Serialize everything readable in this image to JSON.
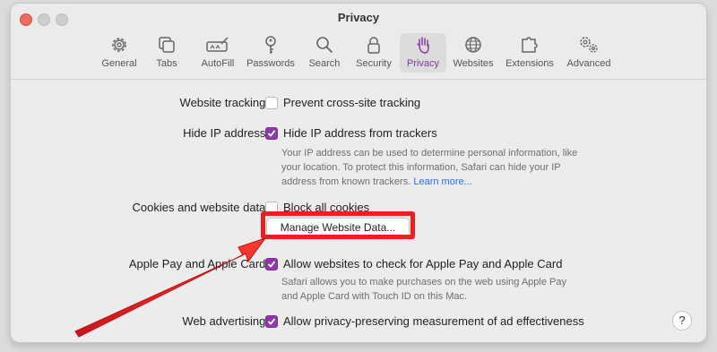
{
  "window": {
    "title": "Privacy"
  },
  "toolbar": {
    "tabs": [
      {
        "label": "General",
        "icon": "gear-icon"
      },
      {
        "label": "Tabs",
        "icon": "tabs-icon"
      },
      {
        "label": "AutoFill",
        "icon": "autofill-icon"
      },
      {
        "label": "Passwords",
        "icon": "key-icon"
      },
      {
        "label": "Search",
        "icon": "search-icon"
      },
      {
        "label": "Security",
        "icon": "lock-icon"
      },
      {
        "label": "Privacy",
        "icon": "hand-icon",
        "active": true
      },
      {
        "label": "Websites",
        "icon": "globe-icon"
      },
      {
        "label": "Extensions",
        "icon": "puzzle-icon"
      },
      {
        "label": "Advanced",
        "icon": "gears-icon"
      }
    ]
  },
  "settings": {
    "website_tracking": {
      "label": "Website tracking:",
      "option": "Prevent cross-site tracking",
      "checked": false
    },
    "hide_ip": {
      "label": "Hide IP address:",
      "option": "Hide IP address from trackers",
      "checked": true,
      "note_lines": [
        "Your IP address can be used to determine personal information, like",
        "your location. To protect this information, Safari can hide your IP",
        "address from known trackers."
      ],
      "learn_more": "Learn more..."
    },
    "cookies": {
      "label": "Cookies and website data:",
      "option": "Block all cookies",
      "checked": false,
      "button": "Manage Website Data..."
    },
    "apple_pay": {
      "label": "Apple Pay and Apple Card:",
      "option": "Allow websites to check for Apple Pay and Apple Card",
      "checked": true,
      "note_lines": [
        "Safari allows you to make purchases on the web using Apple Pay",
        "and Apple Card with Touch ID on this Mac."
      ]
    },
    "web_ads": {
      "label": "Web advertising:",
      "option": "Allow privacy-preserving measurement of ad effectiveness",
      "checked": true
    }
  },
  "help_label": "?",
  "colors": {
    "accent": "#8c3ba5",
    "highlight": "#e8201f",
    "link": "#2a6fd6"
  }
}
